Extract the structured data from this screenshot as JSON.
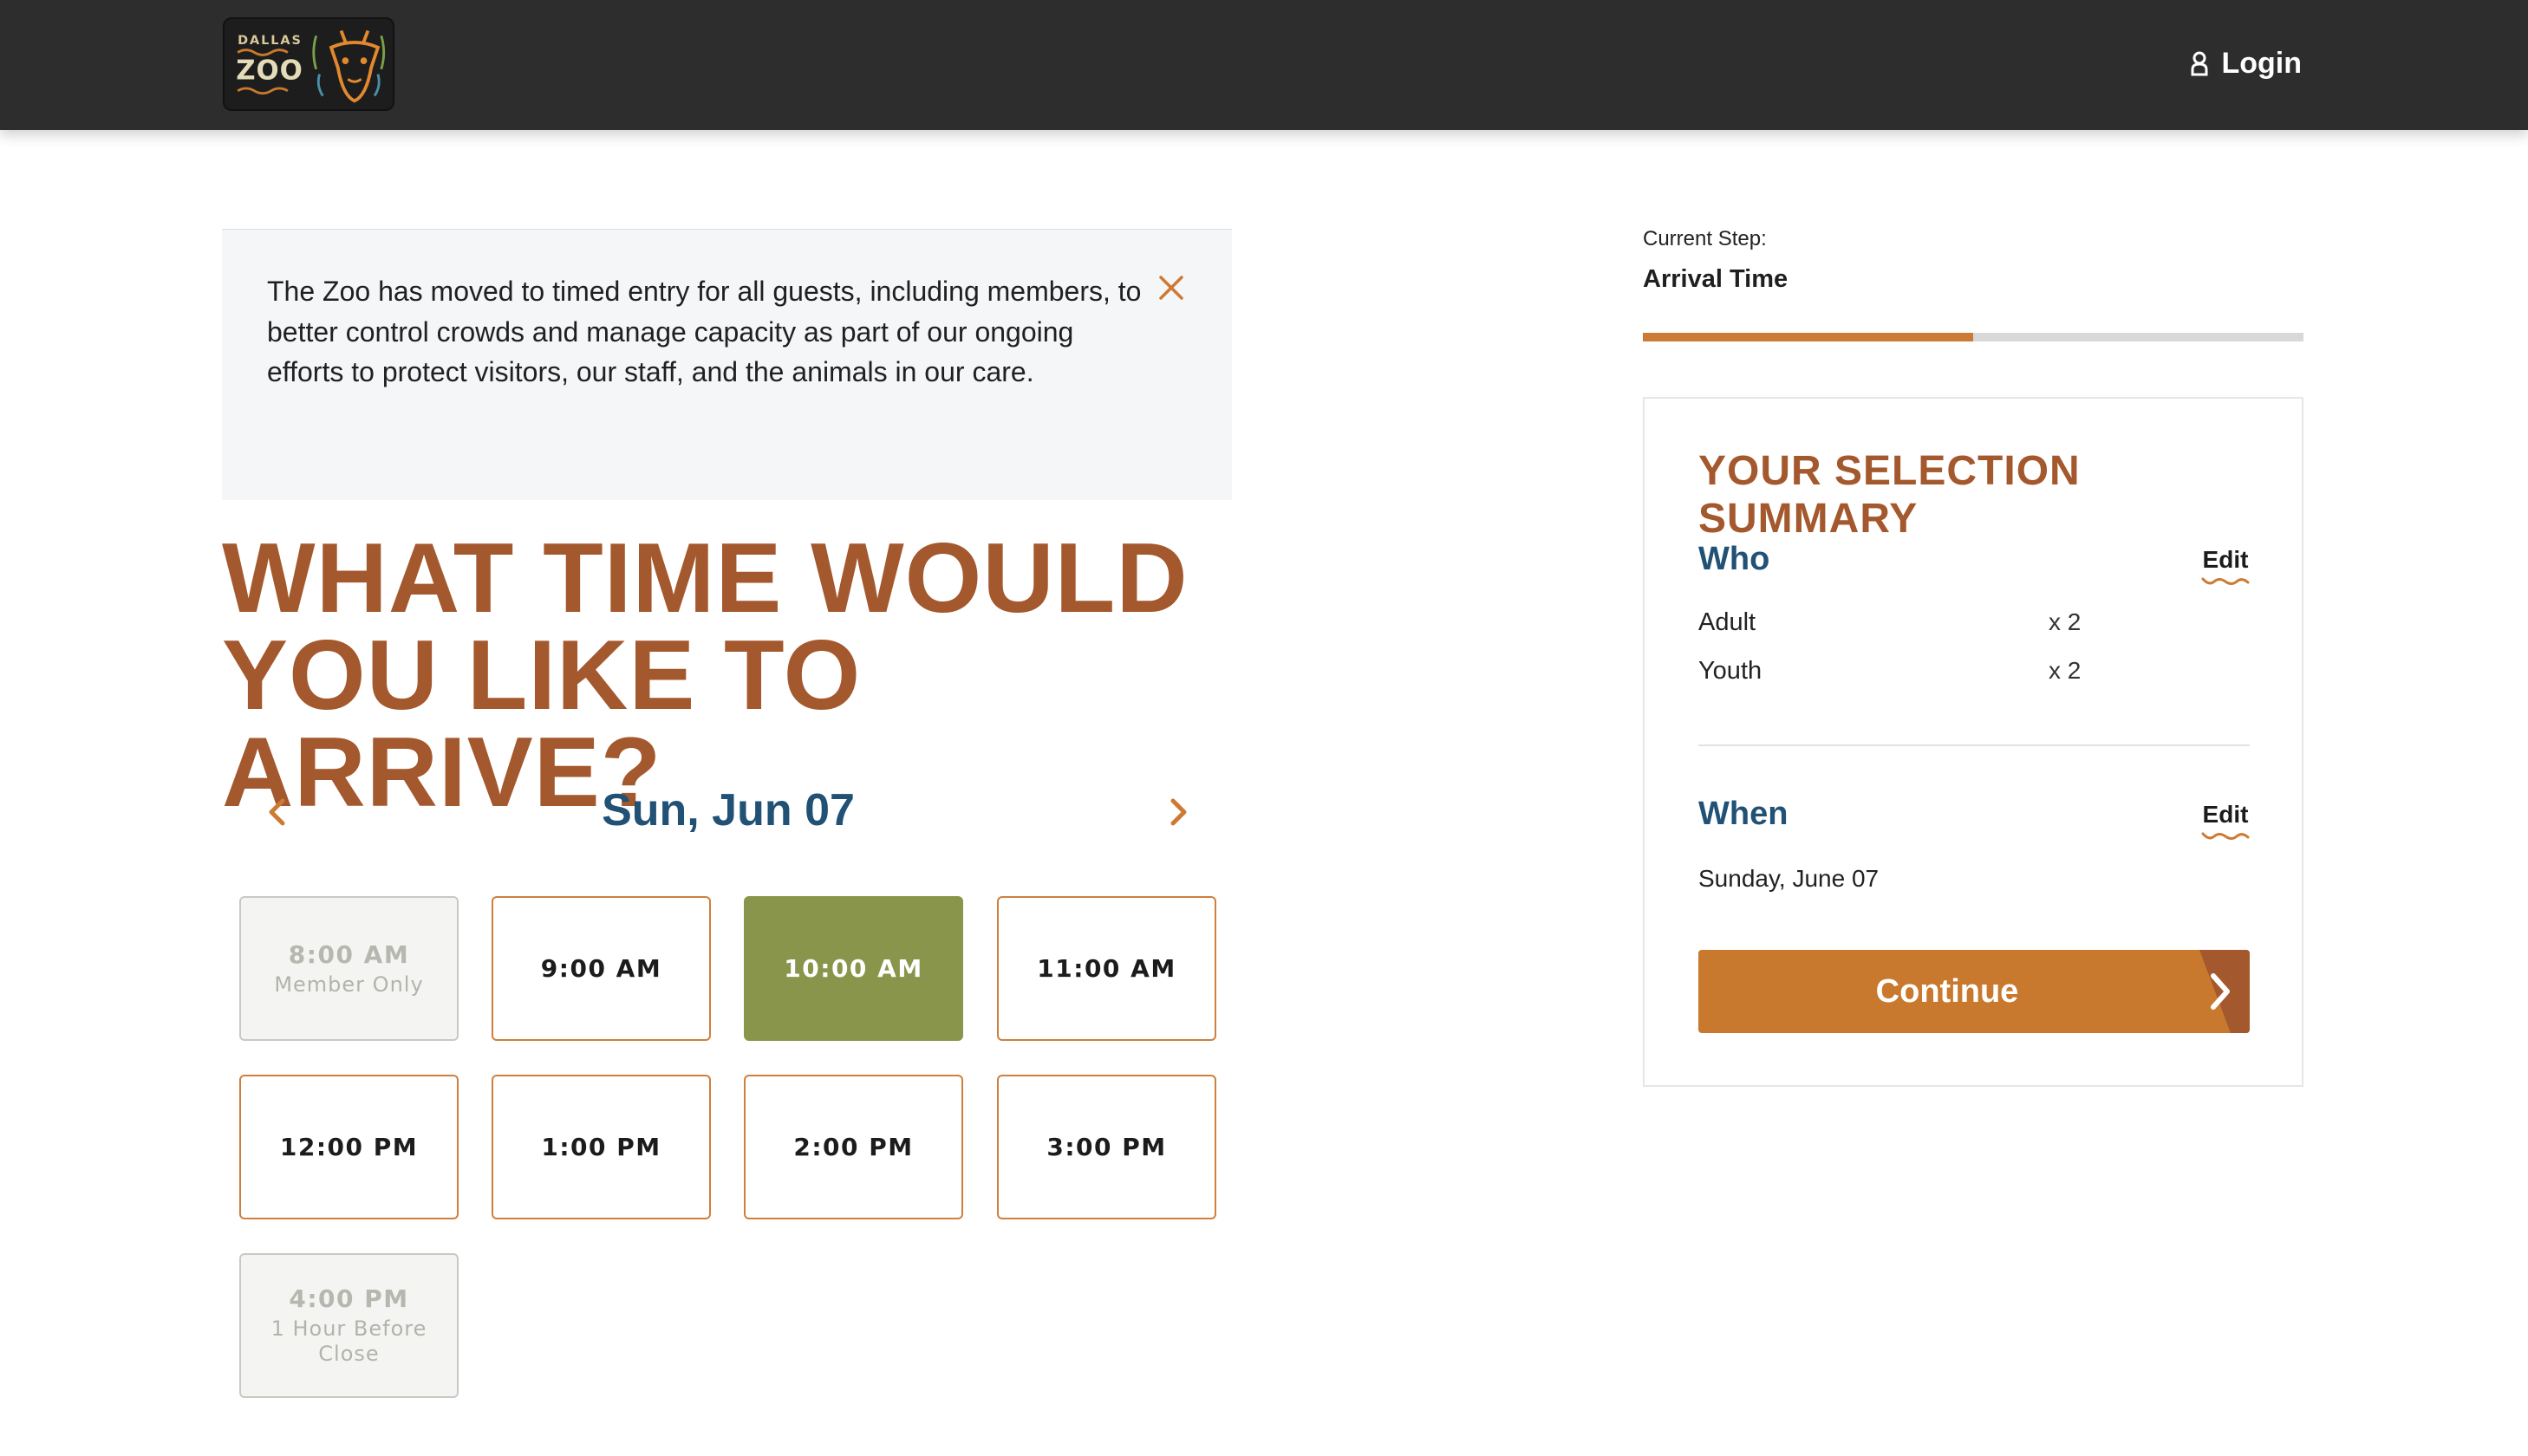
{
  "header": {
    "logo_top_text": "DALLAS",
    "logo_main_text": "ZOO",
    "login_label": "Login"
  },
  "notice": {
    "text": "The Zoo has moved to timed entry for all guests, including members, to better control crowds and manage capacity as part of our ongoing efforts to protect visitors, our staff, and the animals in our care."
  },
  "page": {
    "heading_line1": "WHAT TIME WOULD",
    "heading_line2": "YOU LIKE TO ARRIVE?",
    "date_label": "Sun, Jun 07"
  },
  "slots": [
    {
      "time": "8:00 AM",
      "note": "Member Only",
      "state": "disabled"
    },
    {
      "time": "9:00 AM",
      "note": "",
      "state": "available"
    },
    {
      "time": "10:00 AM",
      "note": "",
      "state": "selected"
    },
    {
      "time": "11:00 AM",
      "note": "",
      "state": "available"
    },
    {
      "time": "12:00 PM",
      "note": "",
      "state": "available"
    },
    {
      "time": "1:00 PM",
      "note": "",
      "state": "available"
    },
    {
      "time": "2:00 PM",
      "note": "",
      "state": "available"
    },
    {
      "time": "3:00 PM",
      "note": "",
      "state": "available"
    },
    {
      "time": "4:00 PM",
      "note": "1 Hour Before Close",
      "state": "disabled"
    }
  ],
  "step": {
    "caption": "Current Step:",
    "name": "Arrival Time",
    "progress_percent": 50
  },
  "summary": {
    "title": "YOUR SELECTION SUMMARY",
    "who_title": "Who",
    "edit_label": "Edit",
    "tickets": [
      {
        "label": "Adult",
        "qty": "x 2"
      },
      {
        "label": "Youth",
        "qty": "x 2"
      }
    ],
    "when_title": "When",
    "when_date": "Sunday, June 07",
    "continue_label": "Continue"
  },
  "colors": {
    "header_bg": "#2d2d2d",
    "accent_orange": "#c9792d",
    "heading_brown": "#a4582d",
    "navy": "#215175",
    "selected_green": "#88954b"
  }
}
